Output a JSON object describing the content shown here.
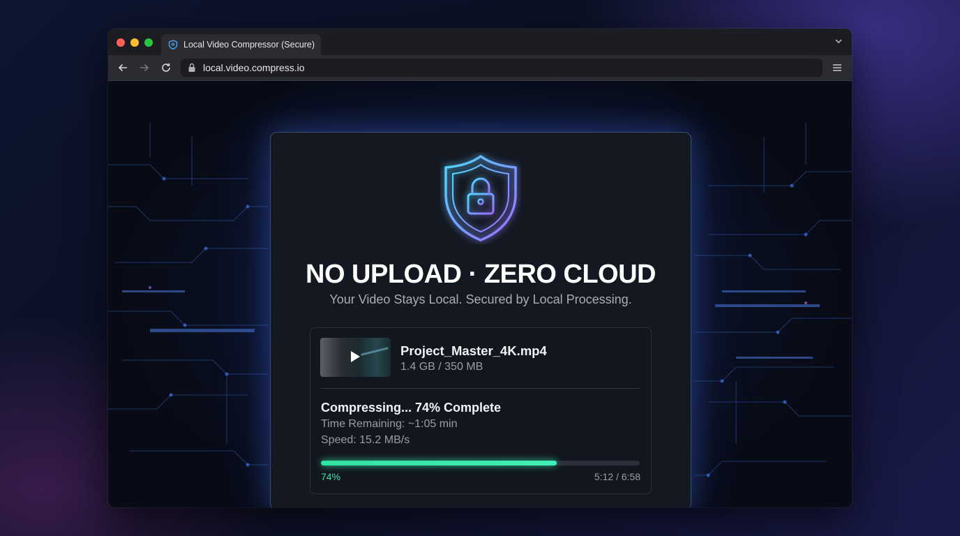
{
  "browser": {
    "tab_title": "Local Video Compressor (Secure)",
    "url": "local.video.compress.io",
    "tab_icon": "shield-icon",
    "back_icon": "arrow-left-icon",
    "forward_icon": "arrow-right-icon",
    "reload_icon": "reload-icon",
    "lock_icon": "lock-icon",
    "menu_icon": "hamburger-icon"
  },
  "hero": {
    "icon": "shield-lock-icon",
    "headline": "NO UPLOAD · ZERO CLOUD",
    "subline": "Your Video Stays Local. Secured by Local Processing."
  },
  "file": {
    "name": "Project_Master_4K.mp4",
    "size": "1.4 GB / 350 MB",
    "thumbnail_icon": "play-icon"
  },
  "progress": {
    "status": "Compressing... 74% Complete",
    "remaining": "Time Remaining: ~1:05 min",
    "speed": "Speed: 15.2 MB/s",
    "percent_label": "74%",
    "percent": 74,
    "time_label": "5:12 / 6:58"
  },
  "colors": {
    "accent_green": "#3fe3a8",
    "shield_cyan": "#4fd8ff",
    "shield_violet": "#9b6bff"
  }
}
